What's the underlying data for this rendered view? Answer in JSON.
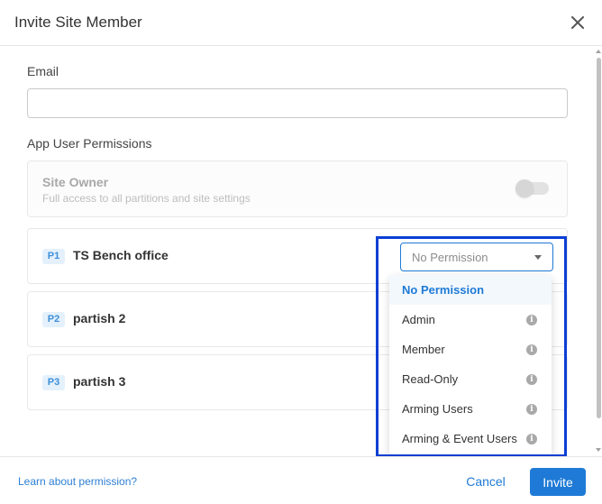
{
  "dialog": {
    "title": "Invite Site Member",
    "close_icon": "close-icon"
  },
  "form": {
    "email_label": "Email",
    "email_value": "",
    "email_placeholder": "",
    "permissions_label": "App User Permissions"
  },
  "site_owner": {
    "title": "Site Owner",
    "description": "Full access to all partitions and site settings",
    "enabled": false
  },
  "partitions": [
    {
      "badge": "P1",
      "name": "TS Bench office",
      "permission": "No Permission"
    },
    {
      "badge": "P2",
      "name": "partish 2"
    },
    {
      "badge": "P3",
      "name": "partish 3"
    }
  ],
  "dropdown": {
    "options": [
      {
        "label": "No Permission",
        "selected": true
      },
      {
        "label": "Admin",
        "info_icon": "info-icon"
      },
      {
        "label": "Member",
        "info_icon": "info-icon"
      },
      {
        "label": "Read-Only",
        "info_icon": "info-icon"
      },
      {
        "label": "Arming Users",
        "info_icon": "info-icon"
      },
      {
        "label": "Arming & Event Users",
        "info_icon": "info-icon"
      }
    ]
  },
  "footer": {
    "learn_link": "Learn about permission?",
    "cancel_label": "Cancel",
    "invite_label": "Invite"
  },
  "colors": {
    "primary": "#1e7ad6",
    "highlight_box": "#0b3fd4",
    "badge_bg": "#e4f1fc"
  }
}
